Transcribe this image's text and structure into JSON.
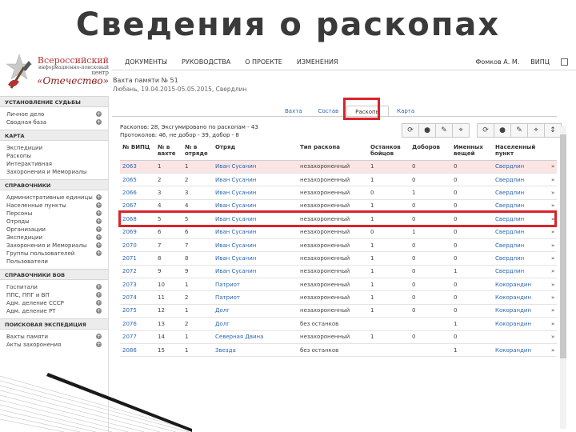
{
  "slide": {
    "title": "Сведения о раскопах"
  },
  "logo": {
    "line1": "Всероссийский",
    "line2": "информационно-поисковый",
    "line3": "центр",
    "line4": "«Отечество»"
  },
  "topnav": {
    "items": [
      "ДОКУМЕНТЫ",
      "РУКОВОДСТВА",
      "О ПРОЕКТЕ",
      "ИЗМЕНЕНИЯ"
    ],
    "user": "Фомков А. М.",
    "org": "ВИПЦ"
  },
  "sidebar": {
    "sections": [
      {
        "title": "УСТАНОВЛЕНИЕ СУДЬБЫ",
        "items": [
          {
            "label": "Личное дело",
            "badge": "+"
          },
          {
            "label": "Сводная база",
            "badge": "+"
          }
        ]
      },
      {
        "title": "КАРТА",
        "items": [
          {
            "label": "Экспедиции",
            "badge": ""
          },
          {
            "label": "Раскопы",
            "badge": ""
          },
          {
            "label": "Интерактивная",
            "badge": ""
          },
          {
            "label": "Захоронения и Мемориалы",
            "badge": ""
          }
        ]
      },
      {
        "title": "СПРАВОЧНИКИ",
        "items": [
          {
            "label": "Административные единицы",
            "badge": "+"
          },
          {
            "label": "Населенные пункты",
            "badge": "+"
          },
          {
            "label": "Персоны",
            "badge": "+"
          },
          {
            "label": "Отряды",
            "badge": "+"
          },
          {
            "label": "Организации",
            "badge": "+"
          },
          {
            "label": "Экспедиции",
            "badge": "+"
          },
          {
            "label": "Захоронения и Мемориалы",
            "badge": "+"
          },
          {
            "label": "Группы пользователей",
            "badge": "+"
          },
          {
            "label": "Пользователи",
            "badge": ""
          }
        ]
      },
      {
        "title": "СПРАВОЧНИКИ ВОВ",
        "items": [
          {
            "label": "Госпитали",
            "badge": "+"
          },
          {
            "label": "ППС, ППГ и ВП",
            "badge": "+"
          },
          {
            "label": "Адм. деление СССР",
            "badge": "+"
          },
          {
            "label": "Адм. деление РТ",
            "badge": "+"
          }
        ]
      },
      {
        "title": "ПОИСКОВАЯ ЭКСПЕДИЦИЯ",
        "items": [
          {
            "label": "Вахты памяти",
            "badge": "+"
          },
          {
            "label": "Акты захоронения",
            "badge": "+"
          }
        ]
      }
    ]
  },
  "main": {
    "title": "Вахта памяти № 51",
    "subtitle": "Любань, 19.04.2015-05.05.2015, Свердлин",
    "tabs": [
      "Вахта",
      "Состав",
      "Раскопы",
      "Карта"
    ],
    "active_tab": 2,
    "stats_line1": "Раскопов: 28, Эксгумировано по раскопам - 43",
    "stats_line2": "Протоколов: 46, не добор - 39, добор - 8",
    "toolbar_left": [
      "⟳",
      "●",
      "✎",
      "⌖"
    ],
    "toolbar_right": [
      "⟳",
      "●",
      "✎",
      "⌖",
      "↕"
    ]
  },
  "table": {
    "headers": [
      "№ ВИПЦ",
      "№ в вахте",
      "№ в отряде",
      "Отряд",
      "Тип раскопа",
      "Останков бойцов",
      "Доборов",
      "Именных вещей",
      "Населенный пункт",
      ""
    ],
    "rows": [
      [
        "2063",
        "1",
        "1",
        "Иван Сусанин",
        "незахороненный",
        "1",
        "0",
        "0",
        "Свердлин",
        "»"
      ],
      [
        "2065",
        "2",
        "2",
        "Иван Сусанин",
        "незахороненный",
        "1",
        "0",
        "0",
        "Свердлин",
        "»"
      ],
      [
        "2066",
        "3",
        "3",
        "Иван Сусанин",
        "незахороненный",
        "0",
        "1",
        "0",
        "Свердлин",
        "»"
      ],
      [
        "2067",
        "4",
        "4",
        "Иван Сусанин",
        "незахороненный",
        "1",
        "0",
        "0",
        "Свердлин",
        "»"
      ],
      [
        "2068",
        "5",
        "5",
        "Иван Сусанин",
        "незахороненный",
        "1",
        "0",
        "0",
        "Свердлин",
        "»"
      ],
      [
        "2069",
        "6",
        "6",
        "Иван Сусанин",
        "незахороненный",
        "0",
        "1",
        "0",
        "Свердлин",
        "»"
      ],
      [
        "2070",
        "7",
        "7",
        "Иван Сусанин",
        "незахороненный",
        "1",
        "0",
        "0",
        "Свердлин",
        "»"
      ],
      [
        "2071",
        "8",
        "8",
        "Иван Сусанин",
        "незахороненный",
        "1",
        "0",
        "0",
        "Свердлин",
        "»"
      ],
      [
        "2072",
        "9",
        "9",
        "Иван Сусанин",
        "незахороненный",
        "1",
        "0",
        "1",
        "Свердлин",
        "»"
      ],
      [
        "2073",
        "10",
        "1",
        "Патриот",
        "незахороненный",
        "1",
        "0",
        "0",
        "Кокорандин",
        "»"
      ],
      [
        "2074",
        "11",
        "2",
        "Патриот",
        "незахороненный",
        "1",
        "0",
        "0",
        "Кокорандин",
        "»"
      ],
      [
        "2075",
        "12",
        "1",
        "Долг",
        "незахороненный",
        "1",
        "0",
        "0",
        "Кокорандин",
        "»"
      ],
      [
        "2076",
        "13",
        "2",
        "Долг",
        "без останков",
        "",
        "",
        "1",
        "Кокорандин",
        "»"
      ],
      [
        "2077",
        "14",
        "1",
        "Северная Двина",
        "незахороненный",
        "1",
        "0",
        "0",
        "",
        "»"
      ],
      [
        "2086",
        "15",
        "1",
        "Звезда",
        "без останков",
        "",
        "",
        "1",
        "Кокорандин",
        "»"
      ]
    ]
  }
}
